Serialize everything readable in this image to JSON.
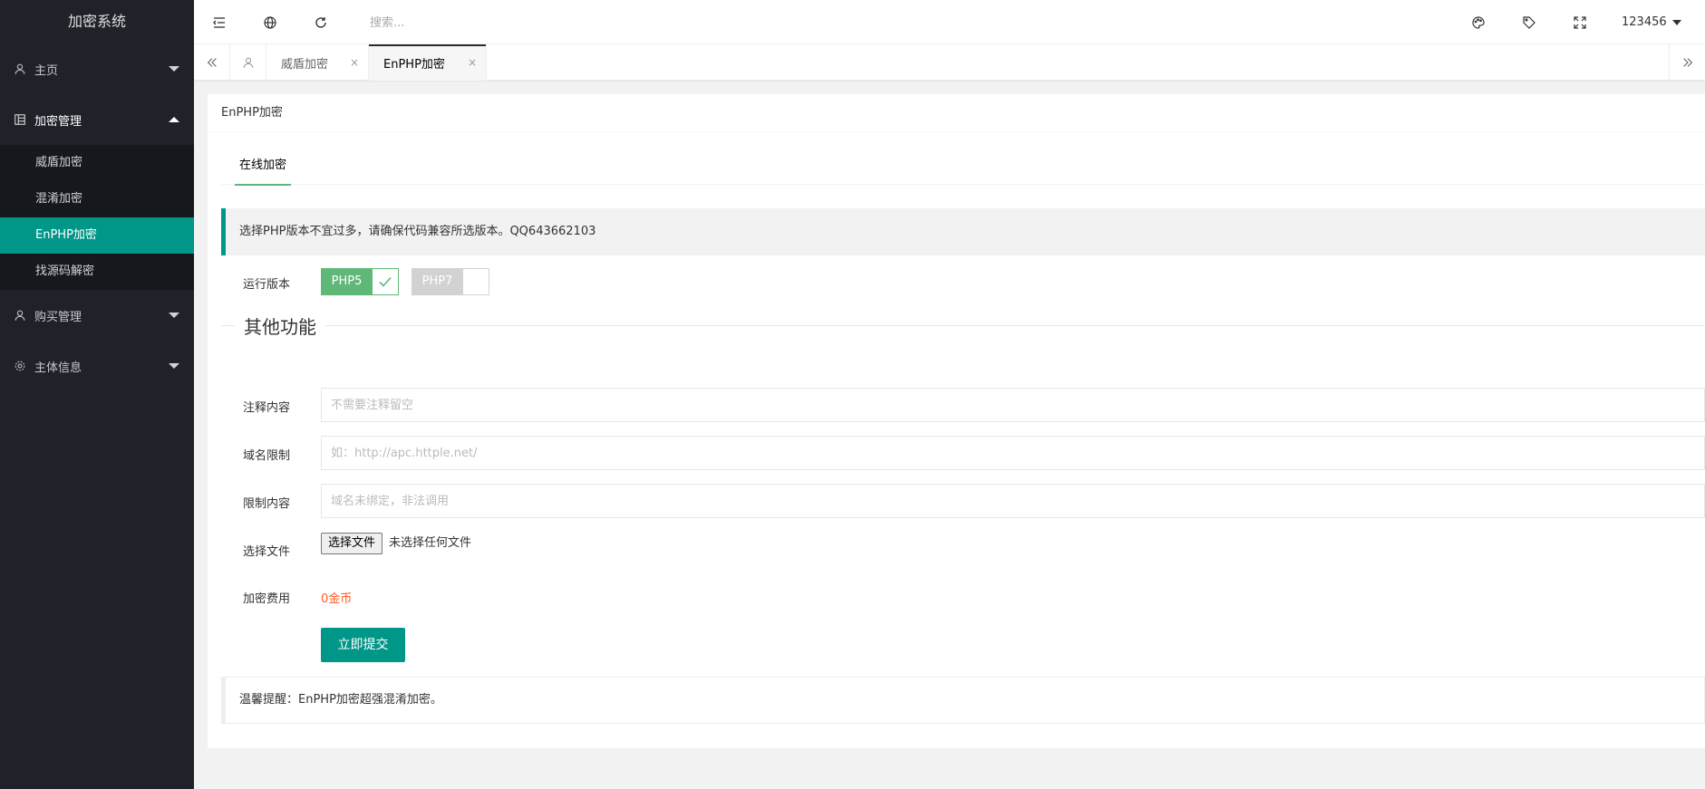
{
  "sidebar": {
    "logo": "加密系统",
    "menu": [
      {
        "label": "主页",
        "icon": "user-icon",
        "expanded": false
      },
      {
        "label": "加密管理",
        "icon": "grid-icon",
        "expanded": true,
        "children": [
          "威盾加密",
          "混淆加密",
          "EnPHP加密",
          "找源码解密"
        ],
        "active_child": "EnPHP加密"
      },
      {
        "label": "购买管理",
        "icon": "user-icon",
        "expanded": false
      },
      {
        "label": "主体信息",
        "icon": "gear-icon",
        "expanded": false
      }
    ]
  },
  "header": {
    "search_placeholder": "搜索...",
    "icons": [
      "menu-toggle-icon",
      "globe-icon",
      "refresh-icon",
      "palette-icon",
      "tag-icon",
      "fullscreen-icon"
    ],
    "username": "123456"
  },
  "tabs": {
    "items": [
      {
        "label": "威盾加密",
        "close": "×"
      },
      {
        "label": "EnPHP加密",
        "close": "×",
        "active": true
      }
    ]
  },
  "card": {
    "title": "EnPHP加密",
    "subtab": "在线加密",
    "notice": "选择PHP版本不宜过多，请确保代码兼容所选版本。QQ643662103",
    "version_label": "运行版本",
    "versions": [
      {
        "label": "PHP5",
        "checked": true
      },
      {
        "label": "PHP7",
        "checked": false
      }
    ],
    "legend": "其他功能",
    "fields": [
      {
        "label": "注释内容",
        "placeholder": "不需要注释留空"
      },
      {
        "label": "域名限制",
        "placeholder": "如：http://apc.httple.net/"
      },
      {
        "label": "限制内容",
        "placeholder": "域名未绑定，非法调用"
      }
    ],
    "file_label": "选择文件",
    "file_button": "选择文件",
    "file_status": "未选择任何文件",
    "fee_label": "加密费用",
    "fee_value": "0金币",
    "submit": "立即提交",
    "tip": "温馨提醒：EnPHP加密超强混淆加密。"
  },
  "colors": {
    "sidebar_bg": "#20222a",
    "accent": "#009688",
    "switch_on": "#5FB878",
    "fee": "#FF5722"
  }
}
